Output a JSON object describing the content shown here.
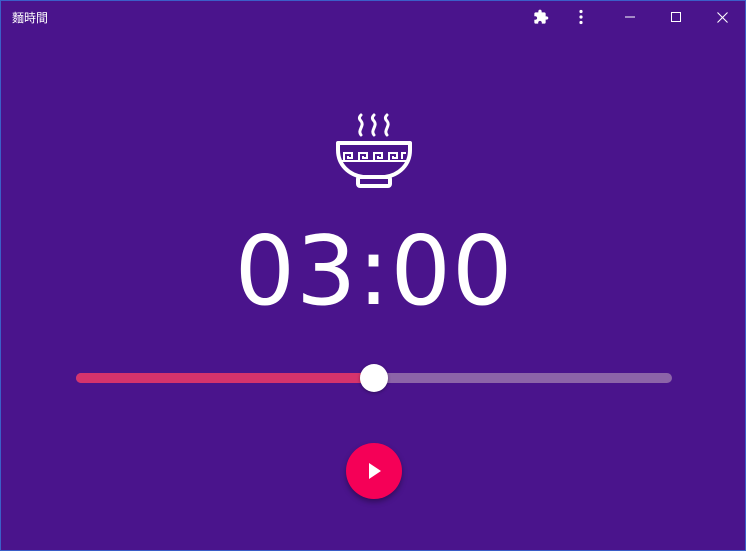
{
  "window": {
    "title": "麵時間"
  },
  "timer": {
    "display": "03:00"
  },
  "slider": {
    "progress": 0.5
  },
  "icons": {
    "extensions": "puzzle-icon",
    "menu": "more-vert-icon",
    "minimize": "minimize-icon",
    "maximize": "maximize-icon",
    "close": "close-icon",
    "bowl": "noodle-bowl-icon",
    "play": "play-icon"
  },
  "colors": {
    "background": "#4a148c",
    "slider_fill": "#d6336c",
    "slider_track": "#8c64a8",
    "slider_thumb": "#ffffff",
    "fab": "#f50057",
    "text": "#ffffff"
  }
}
